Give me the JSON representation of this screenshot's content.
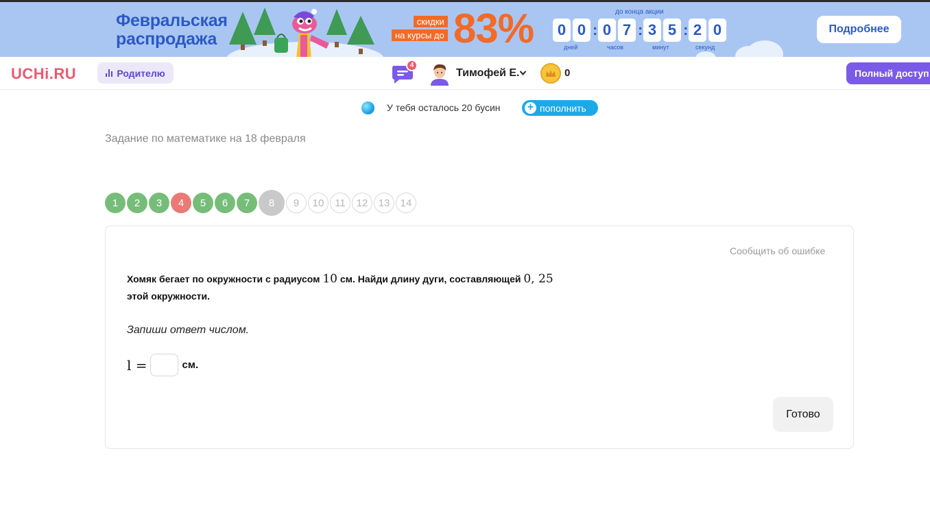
{
  "banner": {
    "title_line1": "Февральская",
    "title_line2": "распродажа",
    "sale_line1": "скидки",
    "sale_line2": "на курсы до",
    "sale_percent": "83%",
    "timer_caption": "до конца акции",
    "timer_digits": [
      "0",
      "0",
      "0",
      "7",
      "3",
      "5",
      "2",
      "0"
    ],
    "timer_units": [
      "дней",
      "часов",
      "минут",
      "секунд"
    ],
    "more_label": "Подробнее"
  },
  "nav": {
    "logo": "UCHi.RU",
    "parent_label": "Родителю",
    "chat_badge": "4",
    "user_name": "Тимофей Е.",
    "coins": "0",
    "full_access_label": "Полный доступ"
  },
  "beads": {
    "text": "У тебя осталось 20 бусин",
    "refill_label": "пополнить"
  },
  "task": {
    "title": "Задание по математике на 18 февраля"
  },
  "steps": [
    {
      "label": "1",
      "status": "done"
    },
    {
      "label": "2",
      "status": "done"
    },
    {
      "label": "3",
      "status": "done"
    },
    {
      "label": "4",
      "status": "wrong"
    },
    {
      "label": "5",
      "status": "done"
    },
    {
      "label": "6",
      "status": "done"
    },
    {
      "label": "7",
      "status": "done"
    },
    {
      "label": "8",
      "status": "current"
    },
    {
      "label": "9",
      "status": "todo"
    },
    {
      "label": "10",
      "status": "todo"
    },
    {
      "label": "11",
      "status": "todo"
    },
    {
      "label": "12",
      "status": "todo"
    },
    {
      "label": "13",
      "status": "todo"
    },
    {
      "label": "14",
      "status": "todo"
    }
  ],
  "card": {
    "report_label": "Сообщить об ошибке",
    "question_part1": "Хомяк бегает по окружности с радиусом ",
    "question_radius": "10",
    "question_part2": " см. Найди длину дуги, составляющей ",
    "question_fraction": "0, 25",
    "question_part3": "этой окружности.",
    "hint": "Запиши ответ числом.",
    "answer_var": "l =",
    "answer_value": "",
    "answer_unit": "см.",
    "done_label": "Готово"
  },
  "colors": {
    "banner_bg": "#a9c6f2",
    "accent_orange": "#f26a27",
    "brand_blue": "#2b59c6",
    "logo_red": "#ea5a6f",
    "purple": "#7a5ae6",
    "step_done": "#76bd79",
    "step_wrong": "#e97a76",
    "step_current": "#c9c9c9",
    "refill_blue": "#1da9e8"
  }
}
